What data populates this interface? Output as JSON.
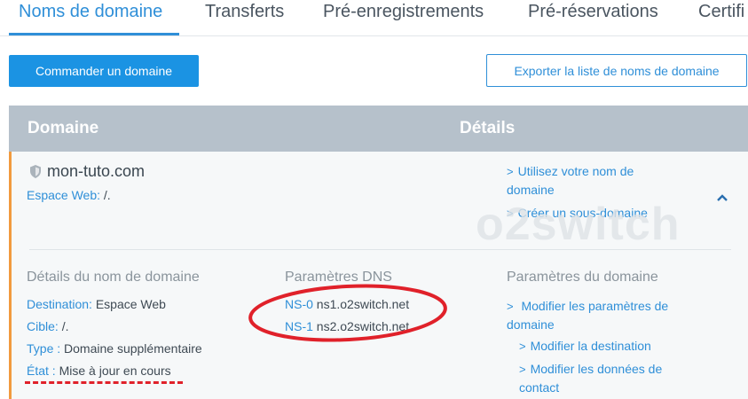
{
  "tabs": [
    {
      "label": "Noms de domaine",
      "active": true
    },
    {
      "label": "Transferts"
    },
    {
      "label": "Pré-enregistrements"
    },
    {
      "label": "Pré-réservations"
    },
    {
      "label": "Certifi"
    }
  ],
  "actions": {
    "order_label": "Commander un domaine",
    "export_label": "Exporter la liste de noms de domaine"
  },
  "table": {
    "col_domain": "Domaine",
    "col_details": "Détails"
  },
  "row": {
    "domain": "mon-tuto.com",
    "espace_label": "Espace Web:",
    "espace_value": "/.",
    "links": [
      {
        "line1": "Utilisez votre nom de",
        "line2": "domaine"
      },
      {
        "line1": "Créer un sous-domaine",
        "line2": ""
      }
    ],
    "details_title": "Détails du nom de domaine",
    "destination_label": "Destination:",
    "destination_value": "Espace Web",
    "cible_label": "Cible:",
    "cible_value": "/.",
    "type_label": "Type :",
    "type_value": "Domaine supplémentaire",
    "etat_label": "État :",
    "etat_value": "Mise à jour en cours",
    "dns_title": "Paramètres DNS",
    "ns": [
      {
        "label": "NS-0",
        "value": "ns1.o2switch.net"
      },
      {
        "label": "NS-1",
        "value": "ns2.o2switch.net"
      }
    ],
    "params_title": "Paramètres du domaine",
    "params_links": {
      "modify_params_1": "Modifier les paramètres de",
      "modify_params_2": "domaine",
      "modify_dest": "Modifier la destination",
      "modify_contact_1": "Modifier les données de",
      "modify_contact_2": "contact"
    }
  },
  "icons": {
    "shield": "shield-icon",
    "chevron_up": "chevron-up-icon",
    "chevron_right": "chevron-right-icon"
  },
  "watermark": "o2switch",
  "colors": {
    "accent": "#1b93e3",
    "link": "#2f8fd8",
    "header_bg": "#b6c1cb",
    "row_border": "#f19a3e",
    "annotation_red": "#e0212a"
  }
}
